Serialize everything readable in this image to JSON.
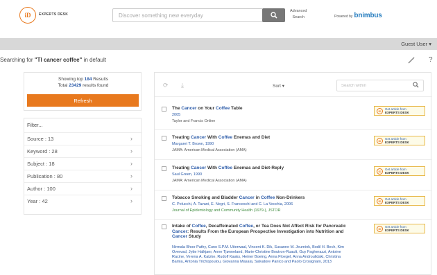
{
  "header": {
    "logo_mark": "iD",
    "logo_text": "EXPERTS DESK",
    "search_placeholder": "Discover something new everyday",
    "advanced_line1": "Advanced",
    "advanced_line2": "Search",
    "powered_by": "Powered by",
    "brand": "bnimbus"
  },
  "topbar": {
    "guest": "Guest User ▾"
  },
  "query": {
    "prefix": "Searching for ",
    "term": "\"Tl cancer coffee\"",
    "suffix": " in default"
  },
  "summary": {
    "showing_prefix": "Showing top ",
    "showing_count": "184",
    "showing_suffix": " Results",
    "total_prefix": "Total ",
    "total_count": "23429",
    "total_suffix": " results found",
    "refresh_label": "Refresh"
  },
  "filters": {
    "title": "Filter...",
    "items": [
      {
        "label": "Source : 13"
      },
      {
        "label": "Keyword : 28"
      },
      {
        "label": "Subject : 18"
      },
      {
        "label": "Publication : 80"
      },
      {
        "label": "Author : 100"
      },
      {
        "label": "Year : 42"
      }
    ]
  },
  "toolbar": {
    "sort_label": "Sort ▾",
    "search_within_placeholder": "Search within"
  },
  "badge": {
    "line1": "Get article from",
    "line2": "EXPERTS DESK"
  },
  "results": [
    {
      "title_parts": [
        "The ",
        "Cancer",
        " on Your ",
        "Coffee",
        " Table"
      ],
      "authors": "2005",
      "source": "Taylor and Francis Online",
      "source_green": false
    },
    {
      "title_parts": [
        "Treating ",
        "Cancer",
        " With ",
        "Coffee",
        " Enemas and Diet"
      ],
      "authors": "Margaret T. Brown, 1990",
      "source": "JAMA: American Medical Association (AMA)",
      "source_green": false
    },
    {
      "title_parts": [
        "Treating ",
        "Cancer",
        " With ",
        "Coffee",
        " Enemas and Diet-Reply"
      ],
      "authors": "Saul Green, 1990",
      "source": "JAMA: American Medical Association (AMA)",
      "source_green": false
    },
    {
      "title_parts": [
        "Tobacco Smoking and Bladder ",
        "Cancer",
        " in ",
        "Coffee",
        " Non-Drinkers"
      ],
      "authors": "C. Pelucchi, A. Tavani, E. Negri, S. Franceschi and C. La Vecchia, 2006",
      "source": "Journal of Epidemiology and Community Health (1979-), JSTOR",
      "source_green": true
    },
    {
      "title_parts": [
        "Intake of ",
        "Coffee",
        ", Decaffeinated ",
        "Coffee",
        ", or Tea Does Not Affect Risk for Pancreatic ",
        "Cancer",
        ": Results From the European Prospective Investigation into Nutrition and ",
        "Cancer",
        " Study"
      ],
      "authors": "Nirmala Bhoo-Pathy, Cuno S.P.M. Uiterwaal, Vincent K. Dik, Susanne M. Jeurnink, Bodil H. Bech, Kim Overvad, Jytte Halkjaer, Anne Tjønneland, Marie-Christine Boutron-Ruault, Guy Fagherazzi, Antoine Racine, Verena A. Katzke, Rudolf Kaaks, Heiner Boeing, Anna Floegel, Anna Androulidaki, Christina Bamia, Antonia Trichopoulou, Giovanna Masala, Salvatore Panico and Paolo Crosignani, 2013",
      "source": "",
      "source_green": false
    }
  ]
}
